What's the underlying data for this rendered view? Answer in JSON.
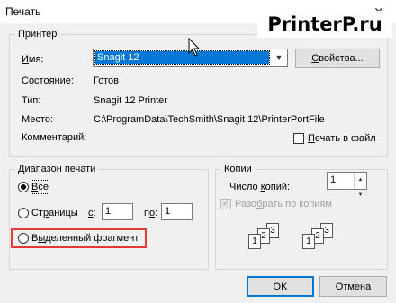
{
  "window": {
    "title": "Печать",
    "close_glyph": "✕"
  },
  "watermark": "PrinterP.ru",
  "printer": {
    "group_title": "Принтер",
    "name_label_underlined": "И",
    "name_label_rest": "мя:",
    "name_value": "Snagit 12",
    "properties_label_underlined": "С",
    "properties_label_rest": "войства...",
    "status_label": "Состояние:",
    "status_value": "Готов",
    "type_label": "Тип:",
    "type_value": "Snagit 12 Printer",
    "where_label": "Место:",
    "where_value": "C:\\ProgramData\\TechSmith\\Snagit 12\\PrinterPortFile",
    "comment_label": "Комментарий:",
    "print_to_file_underlined": "П",
    "print_to_file_rest": "ечать в файл",
    "print_to_file_checked": false
  },
  "range": {
    "group_title": "Диапазон печати",
    "all_underlined": "В",
    "all_rest": "се",
    "all_checked": true,
    "pages_prefix": "Ст",
    "pages_underlined": "р",
    "pages_rest": "аницы",
    "from_underlined": "с",
    "from_rest": ":",
    "from_value": "1",
    "to_prefix": "п",
    "to_underlined": "о",
    "to_rest": ":",
    "to_value": "1",
    "selection_prefix": "В",
    "selection_underlined": "ы",
    "selection_rest": "деленный фрагмент"
  },
  "copies": {
    "group_title": "Копии",
    "count_prefix": "Число ",
    "count_underlined": "к",
    "count_rest": "опий:",
    "count_value": "1",
    "collate_prefix": "Разо",
    "collate_underlined": "б",
    "collate_rest": "рать по копиям",
    "collate_checked": true,
    "collate_enabled": false,
    "page_numbers": [
      "1",
      "2",
      "3"
    ]
  },
  "footer": {
    "ok_label": "OK",
    "cancel_label": "Отмена"
  },
  "colors": {
    "accent": "#0078d7",
    "highlight": "#e53935"
  }
}
